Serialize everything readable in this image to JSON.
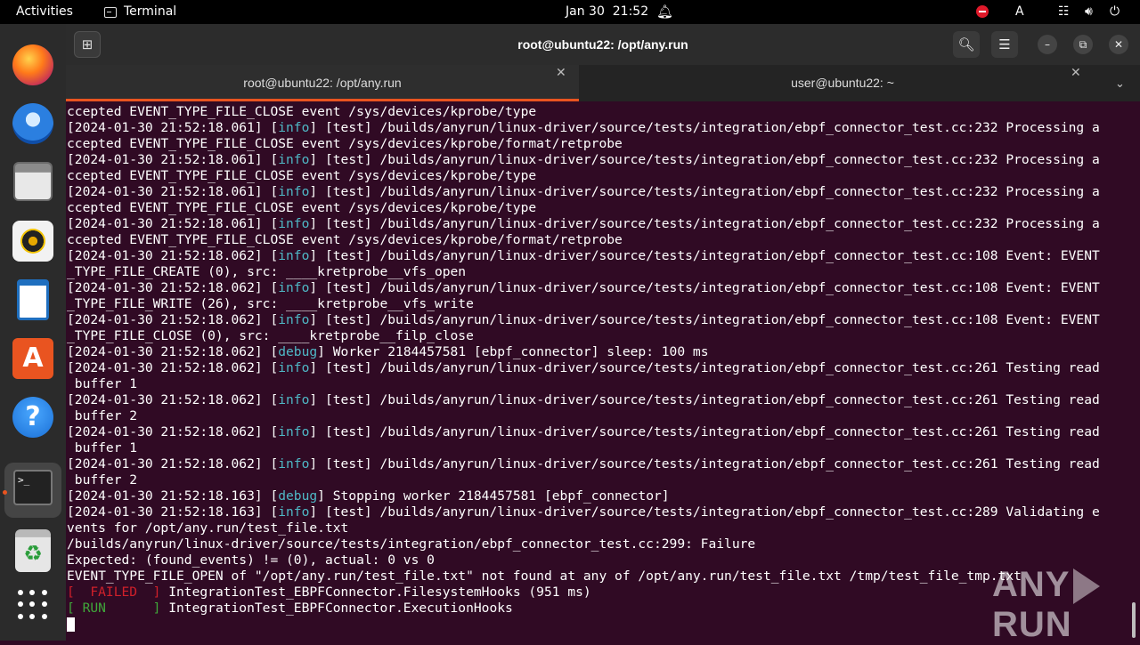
{
  "topbar": {
    "activities": "Activities",
    "app_name": "Terminal",
    "date": "Jan 30",
    "time": "21:52",
    "keyboard_indicator": "A",
    "icons": [
      "bell-icon",
      "record-icon",
      "network-icon",
      "volume-icon",
      "power-icon"
    ]
  },
  "dock": {
    "items": [
      "firefox",
      "thunderbird",
      "files",
      "rhythmbox",
      "libreoffice-writer",
      "app-center",
      "help",
      "terminal",
      "trash",
      "show-apps"
    ]
  },
  "window": {
    "title": "root@ubuntu22: /opt/any.run",
    "tabs": [
      {
        "label": "root@ubuntu22: /opt/any.run",
        "active": true
      },
      {
        "label": "user@ubuntu22: ~",
        "active": false
      }
    ]
  },
  "terminal": {
    "lines": [
      [
        {
          "t": "ccepted EVENT_TYPE_FILE_CLOSE event /sys/devices/kprobe/type"
        }
      ],
      [
        {
          "t": "[2024-01-30 21:52:18.061] ["
        },
        {
          "t": "info",
          "c": "info"
        },
        {
          "t": "] [test] /builds/anyrun/linux-driver/source/tests/integration/ebpf_connector_test.cc:232 Processing a"
        }
      ],
      [
        {
          "t": "ccepted EVENT_TYPE_FILE_CLOSE event /sys/devices/kprobe/format/retprobe"
        }
      ],
      [
        {
          "t": "[2024-01-30 21:52:18.061] ["
        },
        {
          "t": "info",
          "c": "info"
        },
        {
          "t": "] [test] /builds/anyrun/linux-driver/source/tests/integration/ebpf_connector_test.cc:232 Processing a"
        }
      ],
      [
        {
          "t": "ccepted EVENT_TYPE_FILE_CLOSE event /sys/devices/kprobe/type"
        }
      ],
      [
        {
          "t": "[2024-01-30 21:52:18.061] ["
        },
        {
          "t": "info",
          "c": "info"
        },
        {
          "t": "] [test] /builds/anyrun/linux-driver/source/tests/integration/ebpf_connector_test.cc:232 Processing a"
        }
      ],
      [
        {
          "t": "ccepted EVENT_TYPE_FILE_CLOSE event /sys/devices/kprobe/type"
        }
      ],
      [
        {
          "t": "[2024-01-30 21:52:18.061] ["
        },
        {
          "t": "info",
          "c": "info"
        },
        {
          "t": "] [test] /builds/anyrun/linux-driver/source/tests/integration/ebpf_connector_test.cc:232 Processing a"
        }
      ],
      [
        {
          "t": "ccepted EVENT_TYPE_FILE_CLOSE event /sys/devices/kprobe/format/retprobe"
        }
      ],
      [
        {
          "t": "[2024-01-30 21:52:18.062] ["
        },
        {
          "t": "info",
          "c": "info"
        },
        {
          "t": "] [test] /builds/anyrun/linux-driver/source/tests/integration/ebpf_connector_test.cc:108 Event: EVENT"
        }
      ],
      [
        {
          "t": "_TYPE_FILE_CREATE (0), src: ____kretprobe__vfs_open"
        }
      ],
      [
        {
          "t": "[2024-01-30 21:52:18.062] ["
        },
        {
          "t": "info",
          "c": "info"
        },
        {
          "t": "] [test] /builds/anyrun/linux-driver/source/tests/integration/ebpf_connector_test.cc:108 Event: EVENT"
        }
      ],
      [
        {
          "t": "_TYPE_FILE_WRITE (26), src: ____kretprobe__vfs_write"
        }
      ],
      [
        {
          "t": "[2024-01-30 21:52:18.062] ["
        },
        {
          "t": "info",
          "c": "info"
        },
        {
          "t": "] [test] /builds/anyrun/linux-driver/source/tests/integration/ebpf_connector_test.cc:108 Event: EVENT"
        }
      ],
      [
        {
          "t": "_TYPE_FILE_CLOSE (0), src: ____kretprobe__filp_close"
        }
      ],
      [
        {
          "t": "[2024-01-30 21:52:18.062] ["
        },
        {
          "t": "debug",
          "c": "debug"
        },
        {
          "t": "] Worker 2184457581 [ebpf_connector] sleep: 100 ms"
        }
      ],
      [
        {
          "t": "[2024-01-30 21:52:18.062] ["
        },
        {
          "t": "info",
          "c": "info"
        },
        {
          "t": "] [test] /builds/anyrun/linux-driver/source/tests/integration/ebpf_connector_test.cc:261 Testing read"
        }
      ],
      [
        {
          "t": " buffer 1"
        }
      ],
      [
        {
          "t": "[2024-01-30 21:52:18.062] ["
        },
        {
          "t": "info",
          "c": "info"
        },
        {
          "t": "] [test] /builds/anyrun/linux-driver/source/tests/integration/ebpf_connector_test.cc:261 Testing read"
        }
      ],
      [
        {
          "t": " buffer 2"
        }
      ],
      [
        {
          "t": "[2024-01-30 21:52:18.062] ["
        },
        {
          "t": "info",
          "c": "info"
        },
        {
          "t": "] [test] /builds/anyrun/linux-driver/source/tests/integration/ebpf_connector_test.cc:261 Testing read"
        }
      ],
      [
        {
          "t": " buffer 1"
        }
      ],
      [
        {
          "t": "[2024-01-30 21:52:18.062] ["
        },
        {
          "t": "info",
          "c": "info"
        },
        {
          "t": "] [test] /builds/anyrun/linux-driver/source/tests/integration/ebpf_connector_test.cc:261 Testing read"
        }
      ],
      [
        {
          "t": " buffer 2"
        }
      ],
      [
        {
          "t": "[2024-01-30 21:52:18.163] ["
        },
        {
          "t": "debug",
          "c": "debug"
        },
        {
          "t": "] Stopping worker 2184457581 [ebpf_connector]"
        }
      ],
      [
        {
          "t": "[2024-01-30 21:52:18.163] ["
        },
        {
          "t": "info",
          "c": "info"
        },
        {
          "t": "] [test] /builds/anyrun/linux-driver/source/tests/integration/ebpf_connector_test.cc:289 Validating e"
        }
      ],
      [
        {
          "t": "vents for /opt/any.run/test_file.txt"
        }
      ],
      [
        {
          "t": "/builds/anyrun/linux-driver/source/tests/integration/ebpf_connector_test.cc:299: Failure"
        }
      ],
      [
        {
          "t": "Expected: (found_events) != (0), actual: 0 vs 0"
        }
      ],
      [
        {
          "t": "EVENT_TYPE_FILE_OPEN of \"/opt/any.run/test_file.txt\" not found at any of /opt/any.run/test_file.txt /tmp/test_file_tmp.txt"
        }
      ],
      [
        {
          "t": "[  FAILED  ]",
          "c": "failed"
        },
        {
          "t": " IntegrationTest_EBPFConnector.FilesystemHooks (951 ms)"
        }
      ],
      [
        {
          "t": "[ RUN      ]",
          "c": "run"
        },
        {
          "t": " IntegrationTest_EBPFConnector.ExecutionHooks"
        }
      ]
    ]
  },
  "watermark": {
    "left": "ANY",
    "right": "RUN"
  },
  "colors": {
    "terminal_bg": "#300a24",
    "accent": "#e95420",
    "info": "#4fb8c6",
    "failed": "#d0202a",
    "run": "#3fa83a"
  }
}
